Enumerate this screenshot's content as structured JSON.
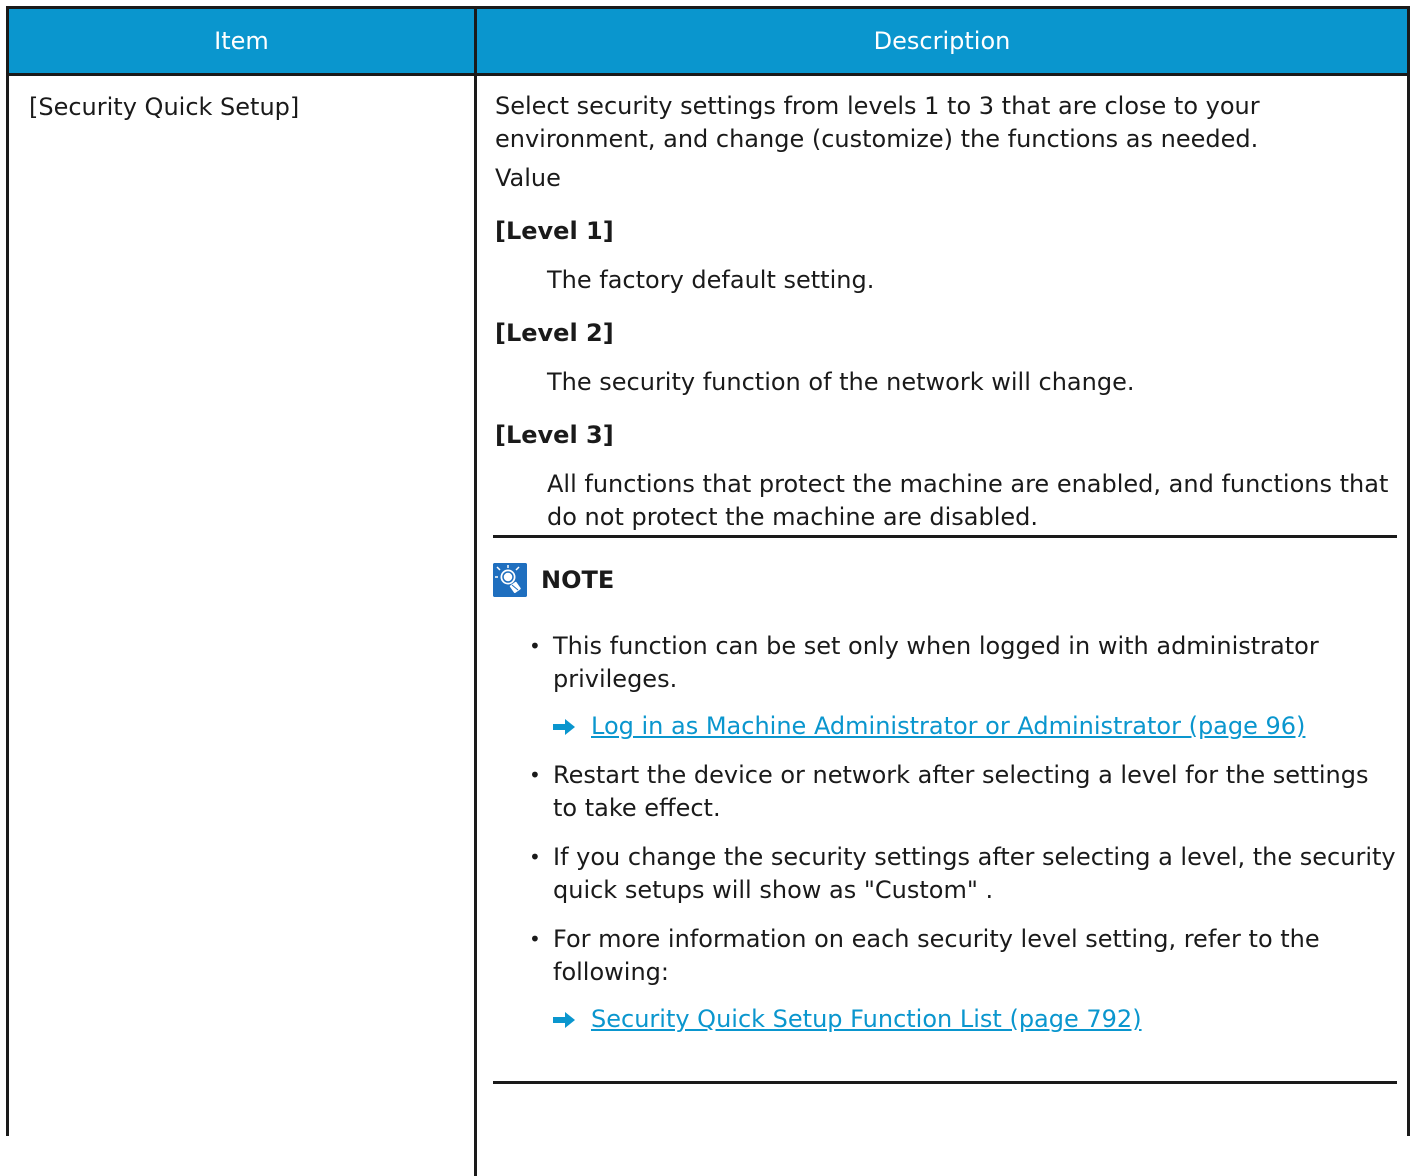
{
  "table": {
    "headers": {
      "item": "Item",
      "description": "Description"
    },
    "row": {
      "item": "[Security Quick Setup]",
      "intro": "Select security settings from levels 1 to 3 that are close to your environment, and change (customize) the functions as needed.",
      "value_label": "Value",
      "levels": [
        {
          "label": "[Level 1]",
          "description": "The factory default setting."
        },
        {
          "label": "[Level 2]",
          "description": "The security function of the network will change."
        },
        {
          "label": "[Level 3]",
          "description": "All functions that protect the machine are enabled, and functions that do not protect the machine are disabled."
        }
      ],
      "note": {
        "title": "NOTE",
        "items": [
          {
            "text": "This function can be set only when logged in with administrator privileges.",
            "link": "Log in as Machine Administrator or Administrator (page 96)"
          },
          {
            "text": "Restart the device or network after selecting a level for the settings to take effect."
          },
          {
            "text": "If you change the security settings after selecting a level, the security quick setups will show as \"Custom\" ."
          },
          {
            "text": "For more information on each security level setting, refer to the following:",
            "link": "Security Quick Setup Function List (page 792)"
          }
        ]
      }
    }
  },
  "colors": {
    "header_bg": "#0a96ce",
    "link": "#0a96ce",
    "border": "#1a1a1a",
    "note_icon": "#1f6fbf"
  },
  "icons": {
    "note": "lightbulb-icon",
    "link_arrow": "right-arrow-icon"
  }
}
